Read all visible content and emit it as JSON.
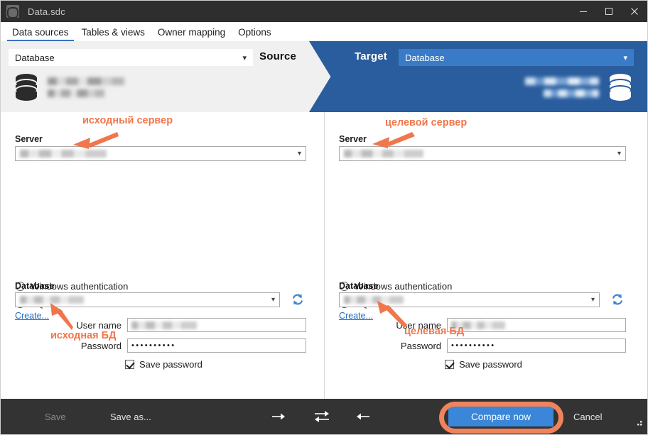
{
  "window": {
    "title": "Data.sdc",
    "app_icon": "db-compare-icon",
    "minimize_icon": "minimize-icon",
    "maximize_icon": "maximize-icon",
    "close_icon": "close-icon"
  },
  "tabs": [
    {
      "label": "Data sources",
      "active": true
    },
    {
      "label": "Tables & views",
      "active": false
    },
    {
      "label": "Owner mapping",
      "active": false
    },
    {
      "label": "Options",
      "active": false
    }
  ],
  "header": {
    "source_role": "Source",
    "target_role": "Target",
    "source_type": "Database",
    "target_type": "Database",
    "chevron_icon": "chevron-down-icon",
    "database_icon": "database-cylinder-icon",
    "accent_blue": "#2a5d9e",
    "select_blue": "#3a7bc8"
  },
  "source_panel": {
    "server_label": "Server",
    "server_value": "",
    "auth_windows": "Windows authentication",
    "auth_sql": "SQL Server authentication",
    "auth_selected": "sql",
    "user_name_label": "User name",
    "user_name_value": "",
    "password_label": "Password",
    "password_value": "••••••••••",
    "save_password_label": "Save password",
    "save_password_checked": true,
    "database_label": "Database",
    "database_value": "",
    "create_link": "Create...",
    "refresh_icon": "refresh-icon"
  },
  "target_panel": {
    "server_label": "Server",
    "server_value": "",
    "auth_windows": "Windows authentication",
    "auth_sql": "SQL Server authentication",
    "auth_selected": "sql",
    "user_name_label": "User name",
    "user_name_value": "",
    "password_label": "Password",
    "password_value": "••••••••••",
    "save_password_label": "Save password",
    "save_password_checked": true,
    "database_label": "Database",
    "database_value": "",
    "create_link": "Create...",
    "refresh_icon": "refresh-icon"
  },
  "annotations": {
    "color": "#f0764c",
    "source_server": "исходный сервер",
    "target_server": "целевой сервер",
    "source_db": "исходная БД",
    "target_db": "целевая БД"
  },
  "bottombar": {
    "save_label": "Save",
    "save_disabled": true,
    "save_as_label": "Save as...",
    "arrow_right_icon": "arrow-right-icon",
    "swap_icon": "swap-arrows-icon",
    "arrow_left_icon": "arrow-left-icon",
    "compare_label": "Compare now",
    "cancel_label": "Cancel",
    "compare_button_color": "#3a86d8",
    "highlight_color": "#f0835c",
    "resize_grip_icon": "resize-grip-icon"
  }
}
